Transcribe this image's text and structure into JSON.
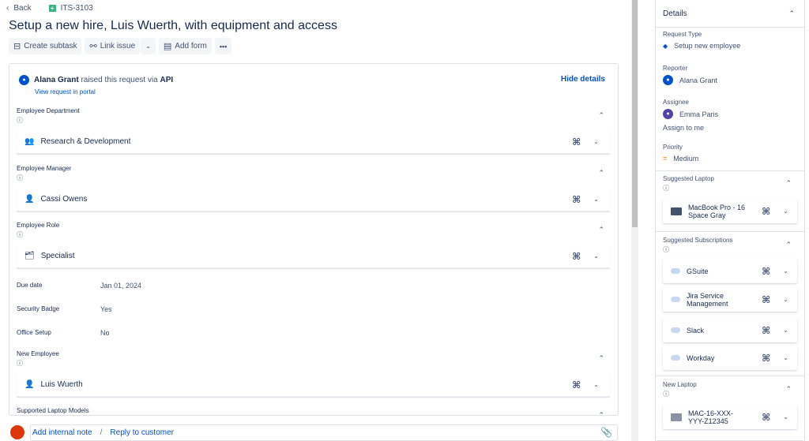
{
  "topbar": {
    "back": "Back",
    "issue_key": "ITS-3103"
  },
  "title": "Setup a new hire, Luis Wuerth, with equipment and access",
  "toolbar": {
    "create_subtask": "Create subtask",
    "link_issue": "Link issue",
    "add_form": "Add form",
    "more": "•••"
  },
  "activity": {
    "reporter": "Alana Grant",
    "raised_text": "raised this request via",
    "channel": "API",
    "view_portal": "View request in portal",
    "hide_details": "Hide details"
  },
  "fields": {
    "department_label": "Employee Department",
    "department_value": "Research & Development",
    "manager_label": "Employee Manager",
    "manager_value": "Cassi Owens",
    "role_label": "Employee Role",
    "role_value": "Specialist",
    "due_label": "Due date",
    "due_value": "Jan 01, 2024",
    "badge_label": "Security Badge",
    "badge_value": "Yes",
    "office_label": "Office Setup",
    "office_value": "No",
    "new_employee_label": "New Employee",
    "new_employee_value": "Luis Wuerth",
    "supported_label": "Supported Laptop Models"
  },
  "comment": {
    "internal": "Add internal note",
    "sep": "/",
    "reply": "Reply to customer"
  },
  "details": {
    "header": "Details",
    "request_type_label": "Request Type",
    "request_type_value": "Setup new employee",
    "reporter_label": "Reporter",
    "reporter_value": "Alana Grant",
    "assignee_label": "Assignee",
    "assignee_value": "Emma Paris",
    "assign_to_me": "Assign to me",
    "priority_label": "Priority",
    "priority_value": "Medium",
    "suggested_laptop_label": "Suggested Laptop",
    "suggested_laptop_value": "MacBook Pro - 16 Space Gray",
    "suggested_subs_label": "Suggested Subscriptions",
    "subs": [
      "GSuite",
      "Jira Service Management",
      "Slack",
      "Workday"
    ],
    "new_laptop_label": "New Laptop",
    "new_laptop_value": "MAC-16-XXX-YYY-Z12345"
  },
  "colors": {
    "link": "#0052cc",
    "priority": "#ff991f"
  }
}
